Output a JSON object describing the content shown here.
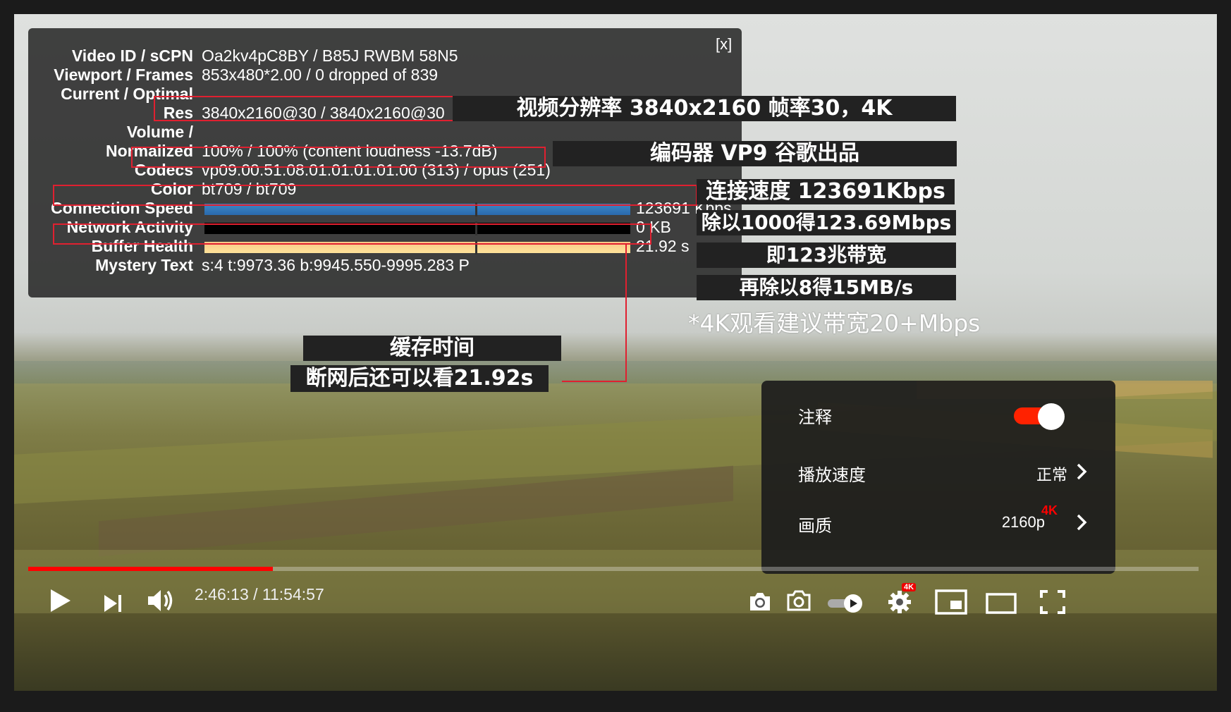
{
  "stats": {
    "close_label": "[x]",
    "rows": [
      {
        "label": "Video ID / sCPN",
        "value": "Oa2kv4pC8BY / B85J RWBM 58N5"
      },
      {
        "label": "Viewport / Frames",
        "value": "853x480*2.00 / 0 dropped of 839"
      },
      {
        "label": "Current / Optimal",
        "value": ""
      },
      {
        "label": "Res",
        "value": "3840x2160@30 / 3840x2160@30"
      },
      {
        "label": "Volume /",
        "value": ""
      },
      {
        "label": "Normalized",
        "value": "100% / 100% (content loudness -13.7dB)"
      },
      {
        "label": "Codecs",
        "value": "vp09.00.51.08.01.01.01.01.00 (313) / opus (251)"
      },
      {
        "label": "Color",
        "value": "bt709 / bt709"
      },
      {
        "label": "Connection Speed",
        "value": "123691 Kbps"
      },
      {
        "label": "Network Activity",
        "value": "0 KB"
      },
      {
        "label": "Buffer Health",
        "value": "21.92 s"
      },
      {
        "label": "Mystery Text",
        "value": "s:4 t:9973.36 b:9945.550-9995.283 P"
      }
    ]
  },
  "annotations": {
    "resolution": "视频分辨率 3840x2160 帧率30，4K",
    "codec": "编码器 VP9 谷歌出品",
    "speed": "连接速度 123691Kbps",
    "divide_1000": "除以1000得123.69Mbps",
    "bandwidth": "即123兆带宽",
    "divide_8": "再除以8得15MB/s",
    "note_4k": "*4K观看建议带宽20+Mbps",
    "buffer_title": "缓存时间",
    "buffer_desc": "断网后还可以看21.92s"
  },
  "settings_menu": {
    "annotations_label": "注释",
    "annotations_on": true,
    "speed_label": "播放速度",
    "speed_value": "正常",
    "quality_label": "画质",
    "quality_value": "2160p",
    "quality_badge": "4K"
  },
  "player": {
    "time_display": "2:46:13 / 11:54:57",
    "progress_fraction": 0.209,
    "settings_badge": "4K"
  },
  "colors": {
    "accent_red": "#ff0000",
    "connection_bar": "#2a6aad",
    "buffer_bar": "#ffe39a",
    "highlight_box": "#e02030"
  }
}
